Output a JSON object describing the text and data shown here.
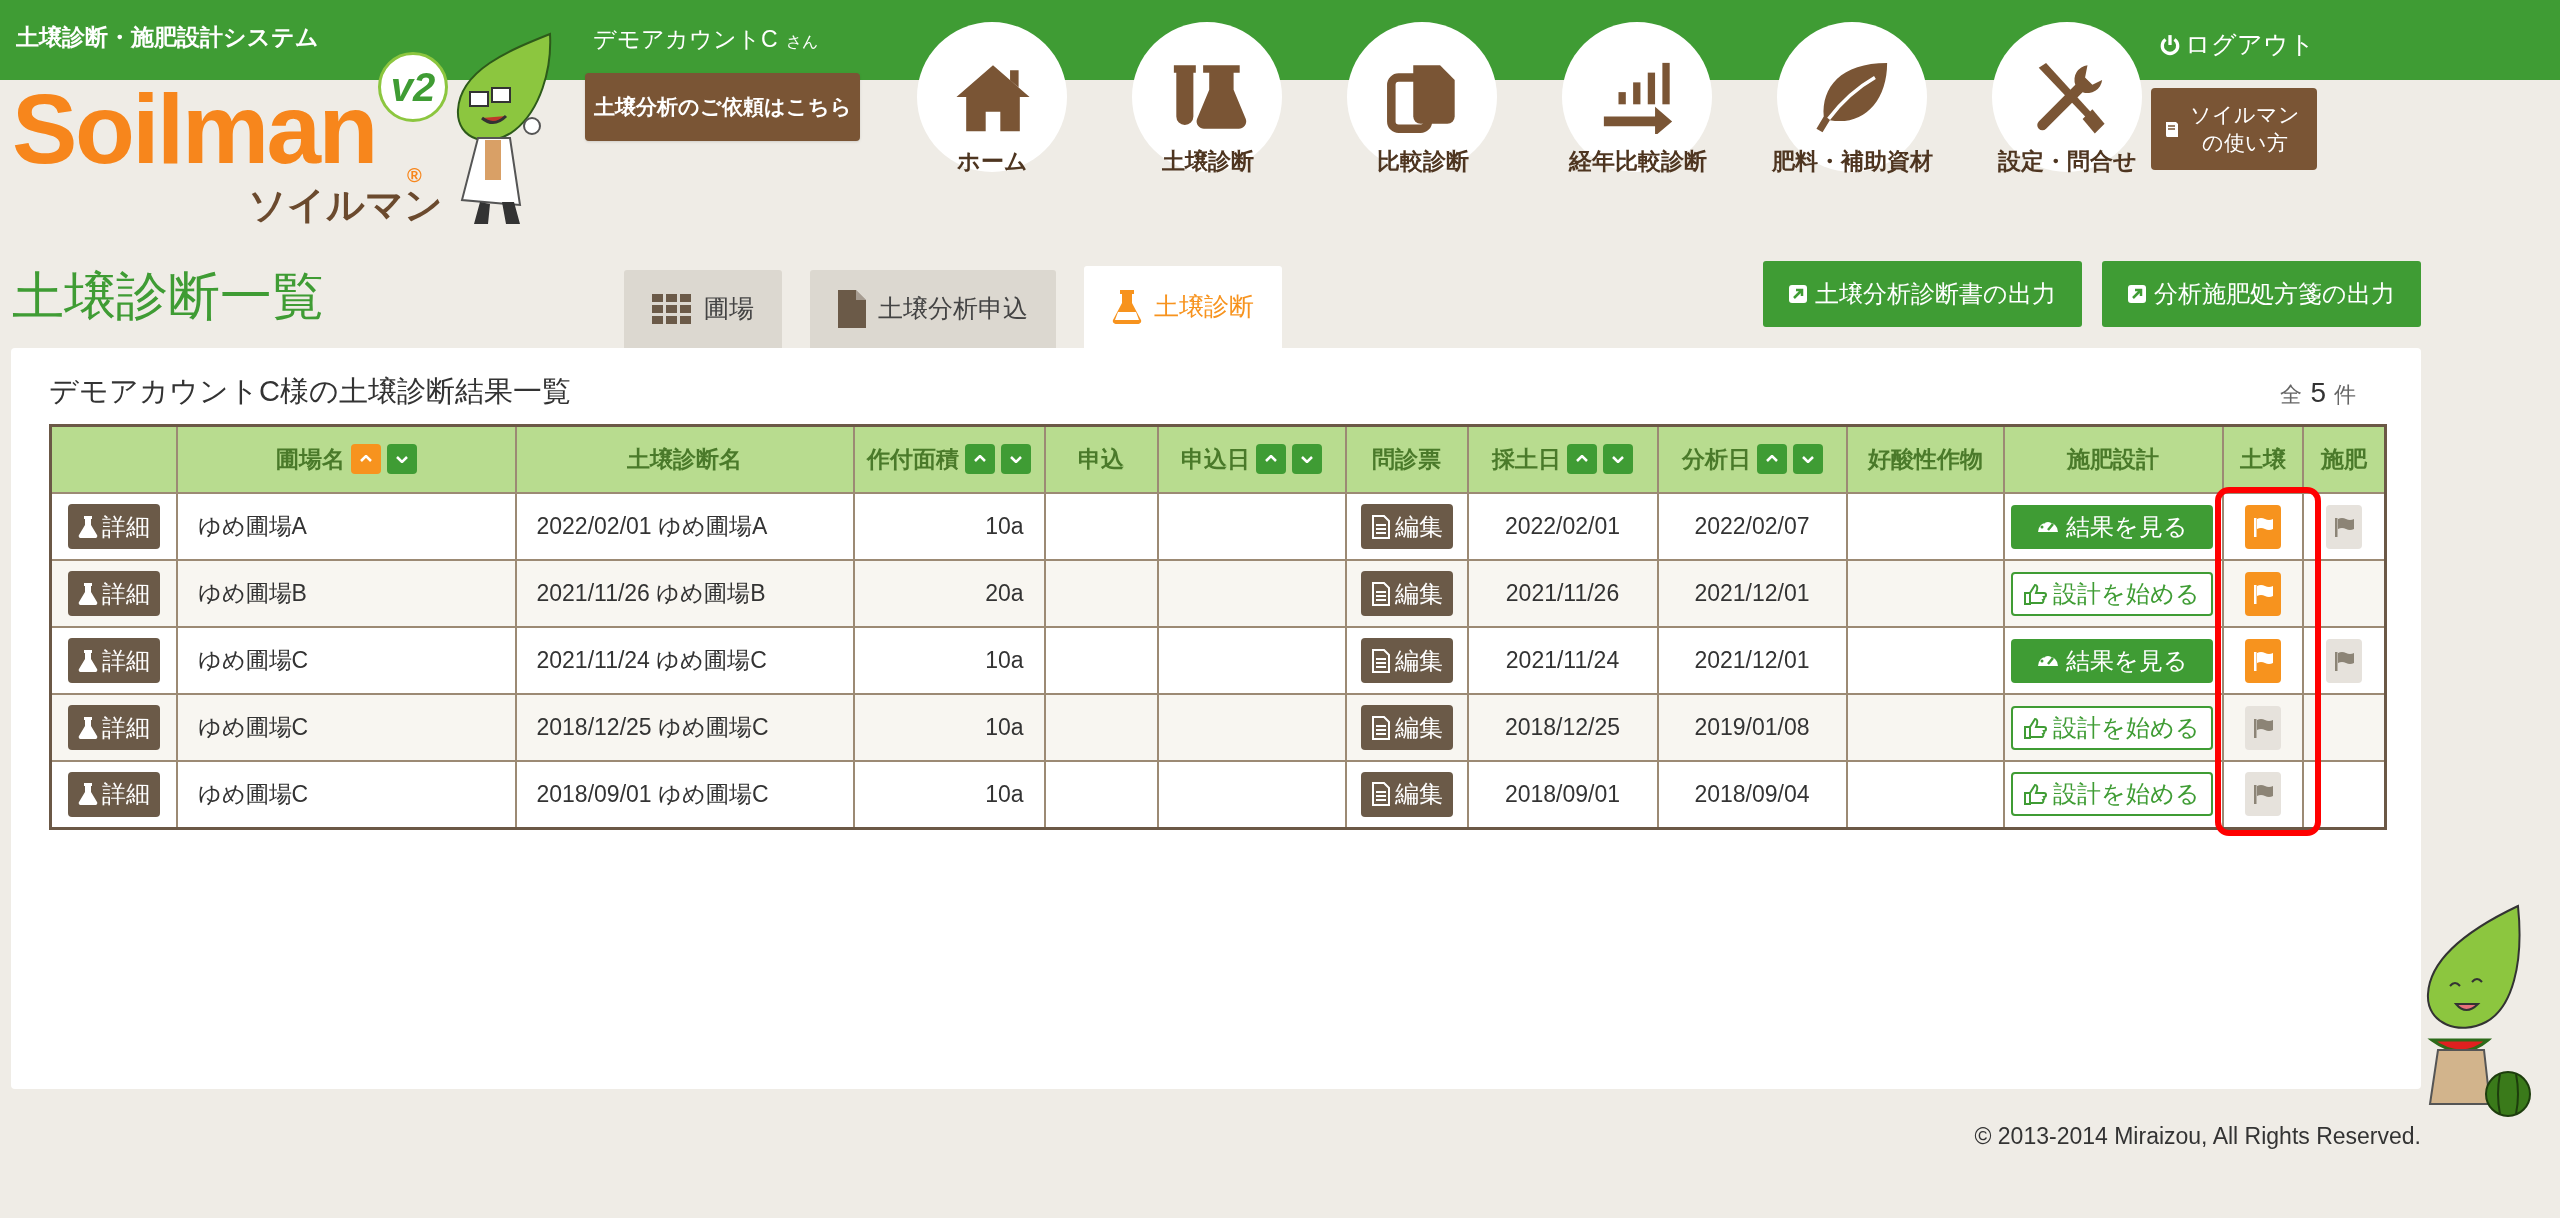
{
  "header": {
    "system_title": "土壌診断・施肥設計システム",
    "logo": {
      "wordmark": "Soilman",
      "registered": "®",
      "kana": "ソイルマン",
      "version": "v2"
    },
    "user": {
      "name": "デモアカウントC",
      "suffix": "さん"
    },
    "request_banner": "土壌分析のご依頼はこちら",
    "nav": [
      {
        "label": "ホーム"
      },
      {
        "label": "土壌診断"
      },
      {
        "label": "比較診断"
      },
      {
        "label": "経年比較診断"
      },
      {
        "label": "肥料・補助資材"
      },
      {
        "label": "設定・問合せ"
      }
    ],
    "logout": "ログアウト",
    "manual_button": "ソイルマンの使い方"
  },
  "page_title": "土壌診断一覧",
  "tabs": [
    {
      "label": "圃場",
      "selected": false
    },
    {
      "label": "土壌分析申込",
      "selected": false
    },
    {
      "label": "土壌診断",
      "selected": true
    }
  ],
  "export_buttons": [
    "土壌分析診断書の出力",
    "分析施肥処方箋の出力"
  ],
  "results": {
    "caption": "デモアカウントC様の土壌診断結果一覧",
    "count": {
      "prefix": "全",
      "value": "5",
      "suffix": "件"
    },
    "columns": [
      {
        "highlighted": false
      },
      {
        "label": "圃場名",
        "highlighted": false,
        "sort_buttons": [
          {
            "kind": "up",
            "selected": true
          },
          {
            "kind": "down",
            "selected": false
          }
        ]
      },
      {
        "label": "土壌診断名",
        "highlighted": false
      },
      {
        "label": "作付面積",
        "highlighted": false,
        "sort_buttons": [
          {
            "kind": "up",
            "selected": false
          },
          {
            "kind": "down",
            "selected": false
          }
        ]
      },
      {
        "label": "申込",
        "highlighted": false
      },
      {
        "label": "申込日",
        "highlighted": false,
        "sort_buttons": [
          {
            "kind": "up",
            "selected": false
          },
          {
            "kind": "down",
            "selected": false
          }
        ]
      },
      {
        "label": "問診票",
        "highlighted": false
      },
      {
        "label": "採土日",
        "highlighted": false,
        "sort_buttons": [
          {
            "kind": "up",
            "selected": false
          },
          {
            "kind": "down",
            "selected": false
          }
        ]
      },
      {
        "label": "分析日",
        "highlighted": false,
        "sort_buttons": [
          {
            "kind": "up",
            "selected": false
          },
          {
            "kind": "down",
            "selected": false
          }
        ]
      },
      {
        "label": "好酸性作物",
        "highlighted": false
      },
      {
        "label": "施肥設計",
        "highlighted": false
      },
      {
        "label": "土壌",
        "highlighted": true
      },
      {
        "label": "施肥",
        "highlighted": false
      }
    ],
    "rows": [
      {
        "detail": "詳細",
        "field": "ゆめ圃場A",
        "diagnosis": "2022/02/01 ゆめ圃場A",
        "area": "10a",
        "questionnaire": "編集",
        "sampling_date": "2022/02/01",
        "analysis_date": "2022/02/07",
        "design": {
          "kind": "view",
          "label": "結果を見る"
        },
        "soil_flag": {
          "active": true
        },
        "fertilizer_flag": {
          "active": false
        }
      },
      {
        "detail": "詳細",
        "field": "ゆめ圃場B",
        "diagnosis": "2021/11/26 ゆめ圃場B",
        "area": "20a",
        "questionnaire": "編集",
        "sampling_date": "2021/11/26",
        "analysis_date": "2021/12/01",
        "design": {
          "kind": "start",
          "label": "設計を始める"
        },
        "soil_flag": {
          "active": true
        }
      },
      {
        "detail": "詳細",
        "field": "ゆめ圃場C",
        "diagnosis": "2021/11/24 ゆめ圃場C",
        "area": "10a",
        "questionnaire": "編集",
        "sampling_date": "2021/11/24",
        "analysis_date": "2021/12/01",
        "design": {
          "kind": "view",
          "label": "結果を見る"
        },
        "soil_flag": {
          "active": true
        },
        "fertilizer_flag": {
          "active": false
        }
      },
      {
        "detail": "詳細",
        "field": "ゆめ圃場C",
        "diagnosis": "2018/12/25 ゆめ圃場C",
        "area": "10a",
        "questionnaire": "編集",
        "sampling_date": "2018/12/25",
        "analysis_date": "2019/01/08",
        "design": {
          "kind": "start",
          "label": "設計を始める"
        },
        "soil_flag": {
          "active": false
        }
      },
      {
        "detail": "詳細",
        "field": "ゆめ圃場C",
        "diagnosis": "2018/09/01 ゆめ圃場C",
        "area": "10a",
        "questionnaire": "編集",
        "sampling_date": "2018/09/01",
        "analysis_date": "2018/09/04",
        "design": {
          "kind": "start",
          "label": "設計を始める"
        },
        "soil_flag": {
          "active": false
        }
      }
    ]
  },
  "footer": "© 2013-2014 Miraizou, All Rights Reserved."
}
